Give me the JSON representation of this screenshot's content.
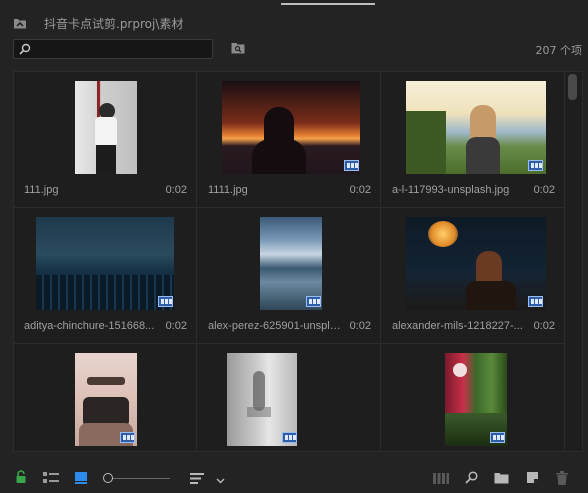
{
  "header": {
    "path": "抖音卡点试剪.prproj\\素材"
  },
  "search": {
    "value": "",
    "placeholder": ""
  },
  "item_count": "207 个项",
  "items": [
    {
      "name": "111.jpg",
      "duration": "0:02"
    },
    {
      "name": "1111.jpg",
      "duration": "0:02"
    },
    {
      "name": "a-l-117993-unsplash.jpg",
      "duration": "0:02"
    },
    {
      "name": "aditya-chinchure-151668...",
      "duration": "0:02"
    },
    {
      "name": "alex-perez-625901-unspla...",
      "duration": "0:02"
    },
    {
      "name": "alexander-mils-1218227-...",
      "duration": "0:02"
    },
    {
      "name": "",
      "duration": ""
    },
    {
      "name": "",
      "duration": ""
    },
    {
      "name": "",
      "duration": ""
    }
  ],
  "icons": {
    "bin_up": "folder-up-icon",
    "find": "find-icon",
    "lock": "lock-icon",
    "list_view": "list-view-icon",
    "icon_view": "icon-view-icon",
    "sort": "sort-icon",
    "automate": "automate-to-sequence-icon",
    "find_bottom": "search-icon",
    "new_bin": "new-bin-icon",
    "new_item": "new-item-icon",
    "clear": "trash-icon"
  },
  "colors": {
    "accent_blue": "#2e5ea8",
    "lock_green": "#3aa64a",
    "icon_view_active": "#2d8ceb"
  }
}
